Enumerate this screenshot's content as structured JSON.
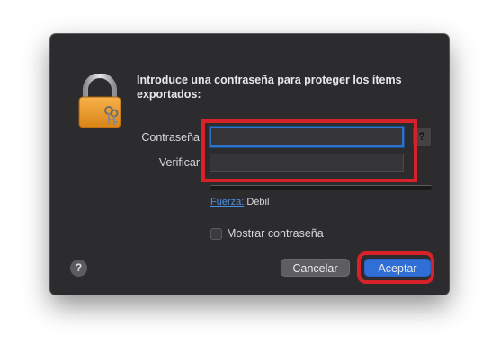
{
  "dialog": {
    "title": "Introduce una contraseña para proteger los ítems exportados:",
    "icon": "keychain-lock-icon"
  },
  "fields": {
    "password_label": "Contraseña",
    "password_value": "",
    "verify_label": "Verificar",
    "verify_value": "",
    "key_assist_label": "?"
  },
  "strength": {
    "link_label": "Fuerza:",
    "value_label": "Débil",
    "level": 0.0
  },
  "options": {
    "show_password_label": "Mostrar contraseña",
    "show_password_checked": false
  },
  "buttons": {
    "help_label": "?",
    "cancel_label": "Cancelar",
    "accept_label": "Aceptar"
  },
  "colors": {
    "dialog_background": "#2c2c2e",
    "accent": "#2f6fd6",
    "annotation_highlight": "#d8222a"
  }
}
